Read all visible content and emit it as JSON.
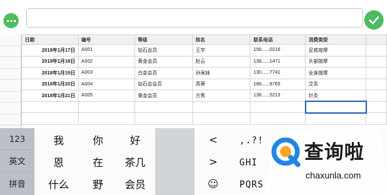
{
  "topbar": {
    "formula_value": "",
    "colors": {
      "accent": "#4dbb5f"
    },
    "icons": {
      "more": "more-dots-icon",
      "confirm": "checkmark-icon"
    }
  },
  "sheet": {
    "headers": [
      "日期",
      "编号",
      "等级",
      "姓名",
      "联系电话",
      "消费类型"
    ],
    "rows": [
      [
        "2018年1月17日",
        "A001",
        "钻石会员",
        "王宇",
        "156......0216",
        "足底按摩"
      ],
      [
        "2018年1月18日",
        "A002",
        "黄金会员",
        "赵云",
        "138......1471",
        "头部按摩"
      ],
      [
        "2018年1月19日",
        "A003",
        "白金会员",
        "孙吴妹",
        "130......7741",
        "全身按摩"
      ],
      [
        "2018年1月20日",
        "A004",
        "钻石会会员",
        "高荣",
        "186......8765",
        "艾灸"
      ],
      [
        "2018年1月21日",
        "A005",
        "黄金会员",
        "方隽",
        "136......5213",
        "针灸"
      ]
    ],
    "selection_color": "#2f63b8"
  },
  "keyboard": {
    "modes": [
      "123",
      "英文",
      "拼音"
    ],
    "candidates": [
      [
        "我",
        "你",
        "好"
      ],
      [
        "恩",
        "在",
        "茶几"
      ],
      [
        "什么",
        "野",
        "会员"
      ]
    ],
    "nav": [
      "<",
      ">",
      "☺"
    ],
    "t9": [
      ",.?!",
      "GHI",
      "PQRS"
    ]
  },
  "watermark": {
    "brand": "查询啦",
    "domain": "chaxunla.com",
    "colors": {
      "ring": "#1f86e6"
    }
  }
}
